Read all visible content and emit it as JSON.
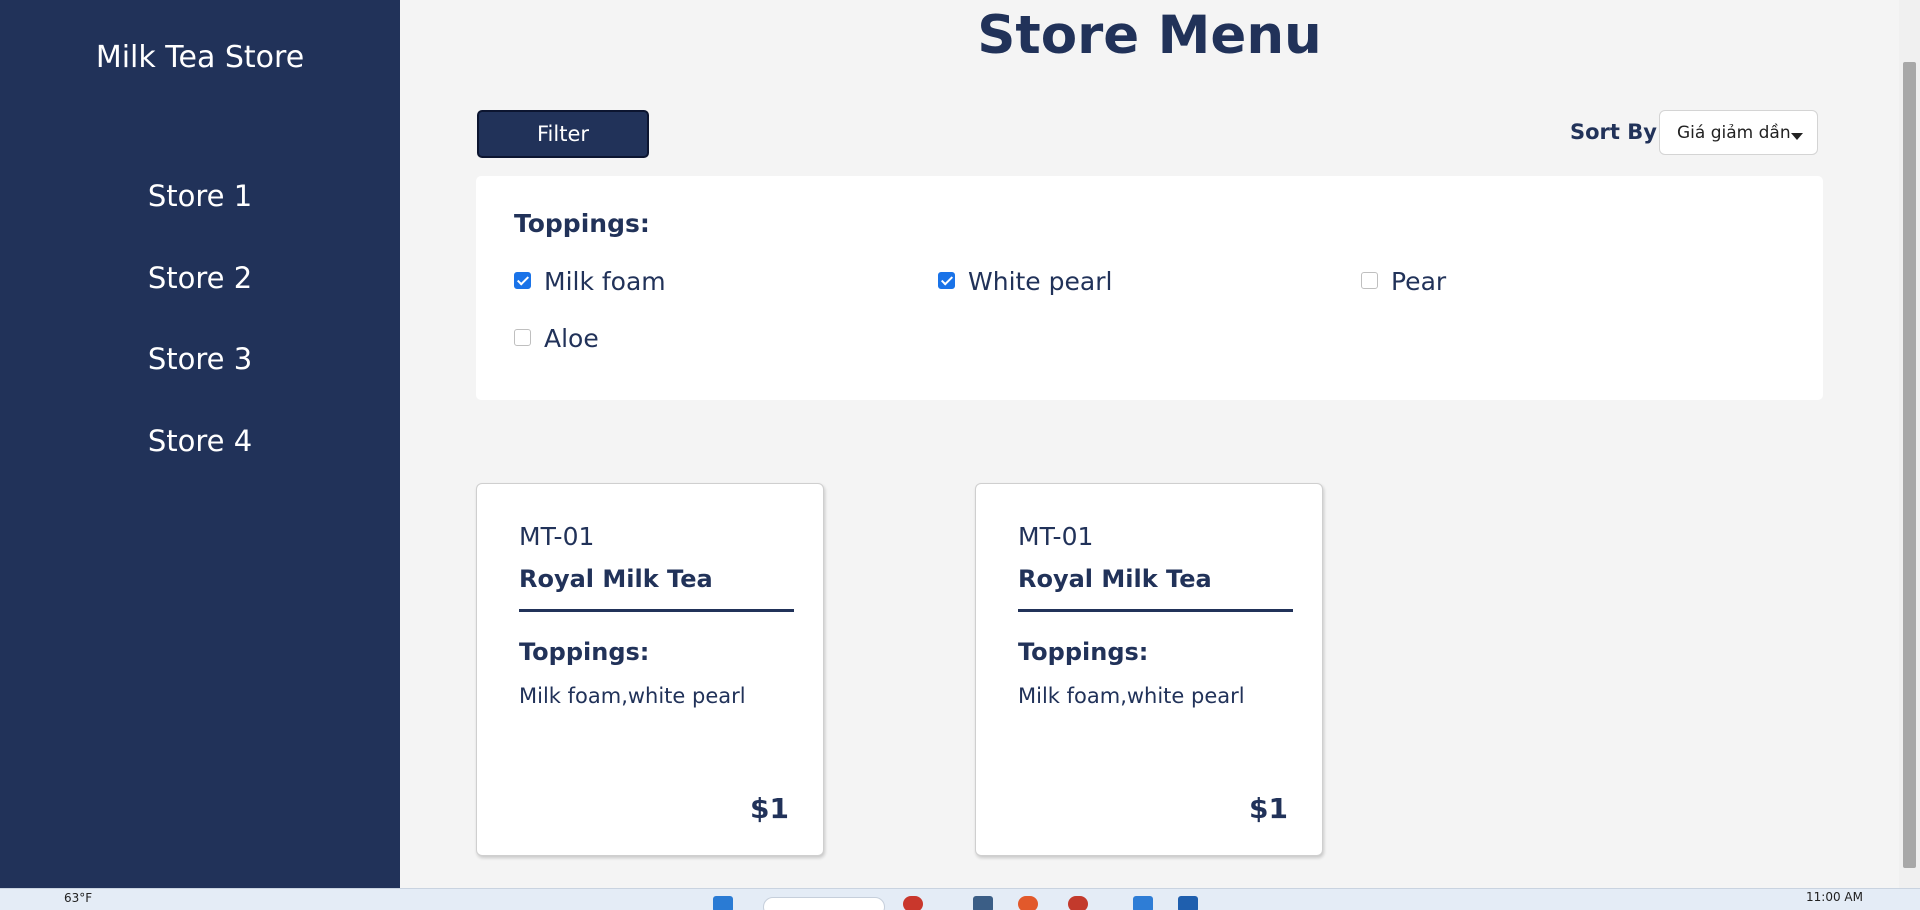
{
  "sidebar": {
    "brand": "Milk Tea Store",
    "items": [
      {
        "label": "Store 1"
      },
      {
        "label": "Store 2"
      },
      {
        "label": "Store 3"
      },
      {
        "label": "Store 4"
      }
    ]
  },
  "header": {
    "title": "Store Menu",
    "filter_label": "Filter",
    "sort_label": "Sort By",
    "sort_value": "Giá giảm dần"
  },
  "filters": {
    "title": "Toppings:",
    "options": [
      {
        "label": "Milk foam",
        "checked": true
      },
      {
        "label": "White pearl",
        "checked": true
      },
      {
        "label": "Pear",
        "checked": false
      },
      {
        "label": "Aloe",
        "checked": false
      }
    ]
  },
  "products": [
    {
      "code": "MT-01",
      "name": "Royal Milk Tea",
      "toppings_label": "Toppings:",
      "toppings": "Milk foam,white pearl",
      "price": "$1"
    },
    {
      "code": "MT-01",
      "name": "Royal Milk Tea",
      "toppings_label": "Toppings:",
      "toppings": "Milk foam,white pearl",
      "price": "$1"
    }
  ],
  "taskbar": {
    "weather": "63°F",
    "time": "11:00 AM"
  },
  "colors": {
    "sidebar": "#213259",
    "accent": "#1a73e8"
  }
}
